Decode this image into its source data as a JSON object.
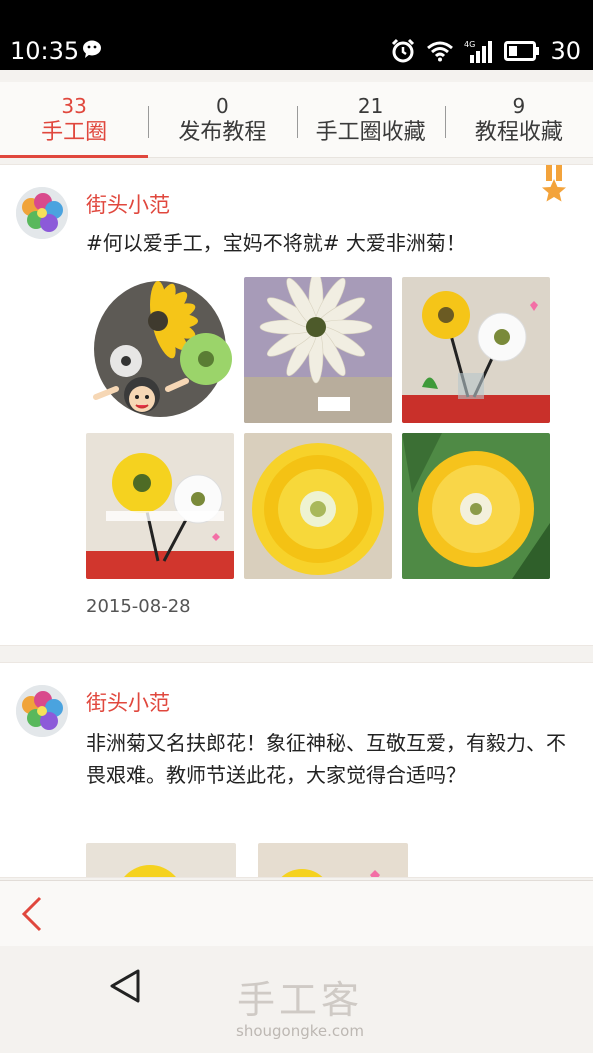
{
  "status_bar": {
    "time": "10:35",
    "battery": "30",
    "network": "4G"
  },
  "tabs": [
    {
      "count": "33",
      "label": "手工圈",
      "active": true
    },
    {
      "count": "0",
      "label": "发布教程",
      "active": false
    },
    {
      "count": "21",
      "label": "手工圈收藏",
      "active": false
    },
    {
      "count": "9",
      "label": "教程收藏",
      "active": false
    }
  ],
  "posts": [
    {
      "username": "街头小范",
      "text": "#何以爱手工，宝妈不将就# 大爱非洲菊！",
      "date": "2015-08-28",
      "photos": [
        "yellow-gerbera-with-cartoon",
        "white-gerbera",
        "yellow-and-white-gerbera-vase",
        "yellow-gerbera-vase",
        "yellow-gerbera-closeup",
        "yellow-gerbera-leaves"
      ]
    },
    {
      "username": "街头小范",
      "text": "非洲菊又名扶郎花！象征神秘、互敬互爱，有毅力、不畏艰难。教师节送此花，大家觉得合适吗？",
      "photos": [
        "yellow-gerbera",
        "yellow-gerbera-pink"
      ]
    }
  ],
  "watermark": {
    "brand": "手工客",
    "url": "shougongke.com"
  },
  "colors": {
    "accent": "#e0473d",
    "flower_yellow": "#f5c518"
  },
  "icons": [
    "wechat-icon",
    "alarm-icon",
    "wifi-icon",
    "signal-icon",
    "battery-icon",
    "medal-icon",
    "back-arrow-icon",
    "nav-back-icon"
  ]
}
